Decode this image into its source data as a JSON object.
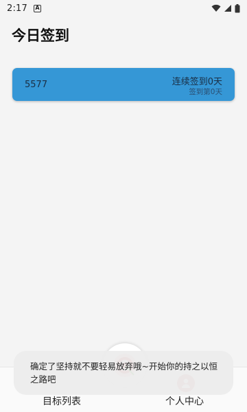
{
  "status_bar": {
    "time": "2:17",
    "app_indicator": "A",
    "icons": [
      "wifi-icon",
      "signal-icon",
      "battery-icon"
    ]
  },
  "page": {
    "title": "今日签到"
  },
  "checkin_card": {
    "number": "5577",
    "streak_text": "连续签到0天",
    "day_text": "签到第0天",
    "color": "#3597d6"
  },
  "bottom_nav": {
    "tabs": [
      {
        "label": "目标列表",
        "icon": "target-icon"
      },
      {
        "label": "个人中心",
        "icon": "person-icon"
      }
    ],
    "center_icon": "target-icon"
  },
  "toast": {
    "message": "确定了坚持就不要轻易放弃哦~开始你的持之以恒之路吧"
  }
}
